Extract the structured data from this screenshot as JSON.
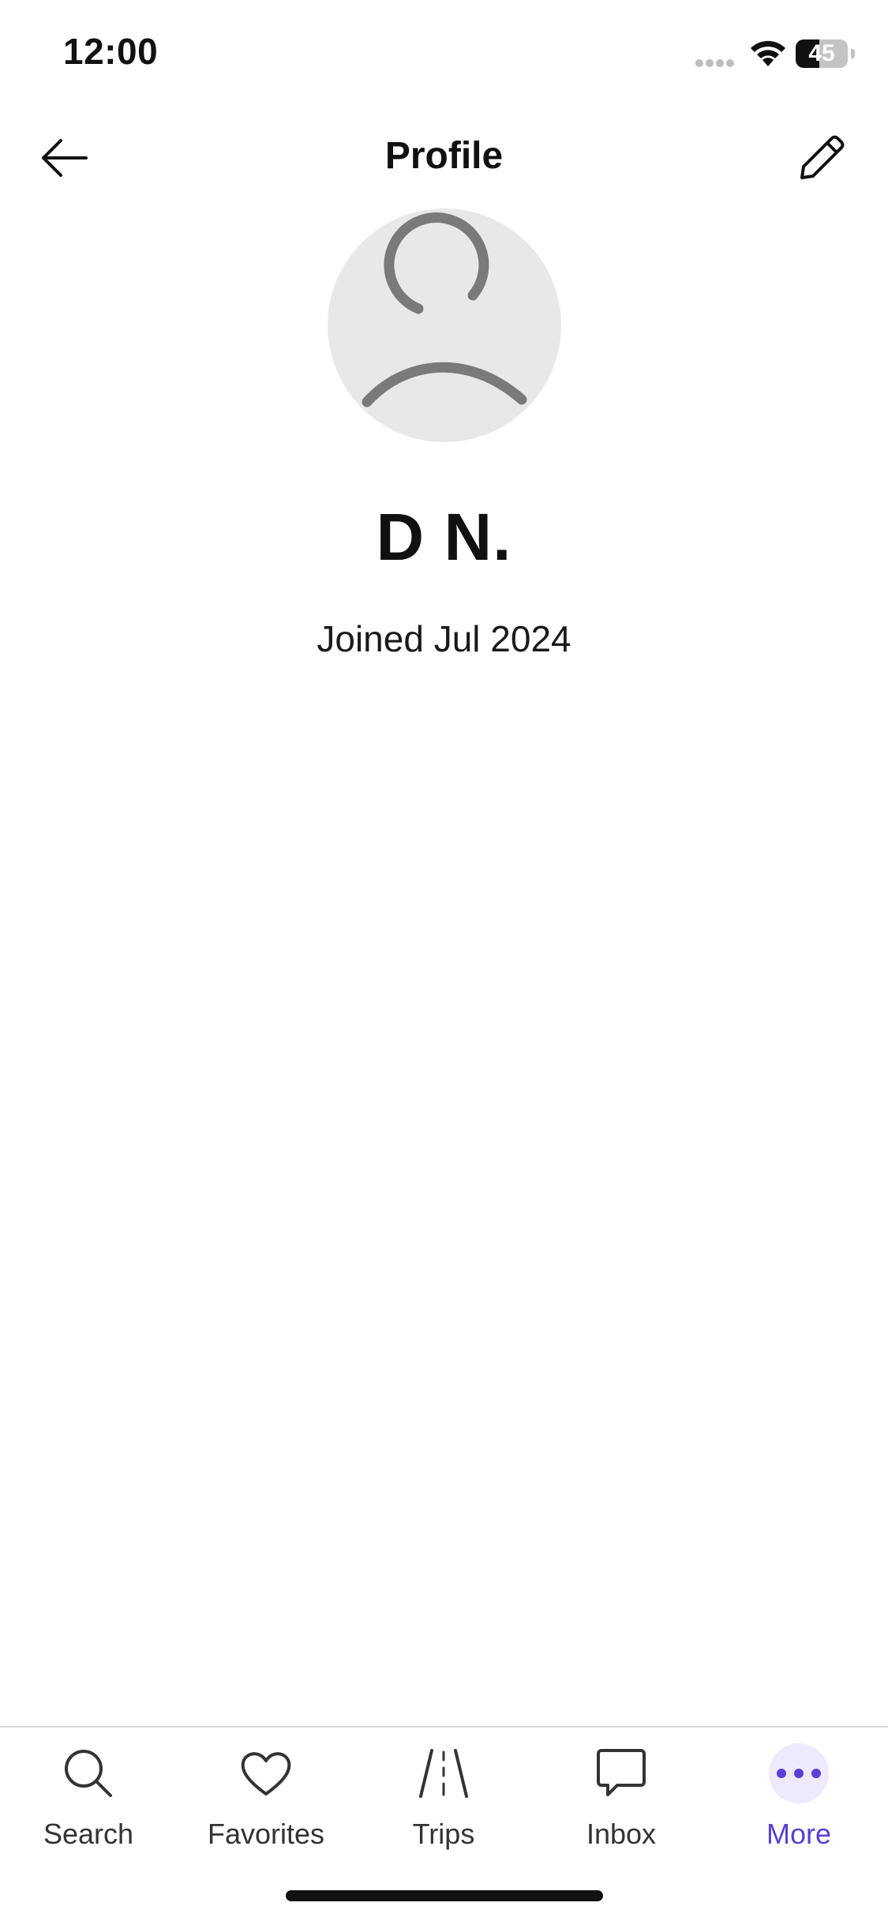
{
  "status_bar": {
    "time": "12:00",
    "battery_level": "45",
    "battery_fraction": 0.45,
    "icons": [
      "signal-dots-icon",
      "wifi-icon",
      "battery-icon"
    ]
  },
  "header": {
    "title": "Profile",
    "back_icon": "arrow-left-icon",
    "edit_icon": "pencil-icon"
  },
  "profile": {
    "avatar_icon": "person-placeholder-icon",
    "name": "D N.",
    "joined": "Joined Jul 2024"
  },
  "tab_bar": {
    "items": [
      {
        "label": "Search",
        "icon": "search-icon",
        "active": false
      },
      {
        "label": "Favorites",
        "icon": "heart-icon",
        "active": false
      },
      {
        "label": "Trips",
        "icon": "road-icon",
        "active": false
      },
      {
        "label": "Inbox",
        "icon": "chat-bubble-icon",
        "active": false
      },
      {
        "label": "More",
        "icon": "more-dots-icon",
        "active": true
      }
    ]
  },
  "colors": {
    "accent": "#5a3fd6",
    "accent_bubble": "#eee9fb",
    "avatar_bg": "#e8e8e8",
    "avatar_fg": "#7a7a7a",
    "text": "#111111",
    "tab_label": "#333333",
    "divider": "#d9d9d9"
  }
}
